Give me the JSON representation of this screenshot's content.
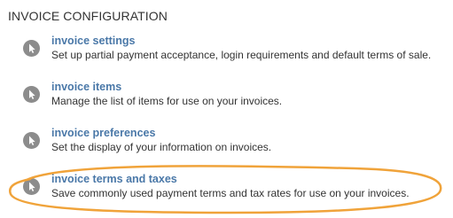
{
  "section": {
    "title": "INVOICE CONFIGURATION"
  },
  "items": [
    {
      "icon": "cursor-arrow-icon",
      "title": "invoice settings",
      "description": "Set up partial payment acceptance, login requirements and default terms of sale."
    },
    {
      "icon": "cursor-arrow-icon",
      "title": "invoice items",
      "description": "Manage the list of items for use on your invoices."
    },
    {
      "icon": "cursor-arrow-icon",
      "title": "invoice preferences",
      "description": "Set the display of your information on invoices."
    },
    {
      "icon": "cursor-arrow-icon",
      "title": "invoice terms and taxes",
      "description": "Save commonly used payment terms and tax rates for use on your invoices."
    }
  ],
  "colors": {
    "link": "#4a78a8",
    "text": "#333333",
    "icon_bg": "#8c8c8c",
    "highlight": "#f0a33a"
  }
}
